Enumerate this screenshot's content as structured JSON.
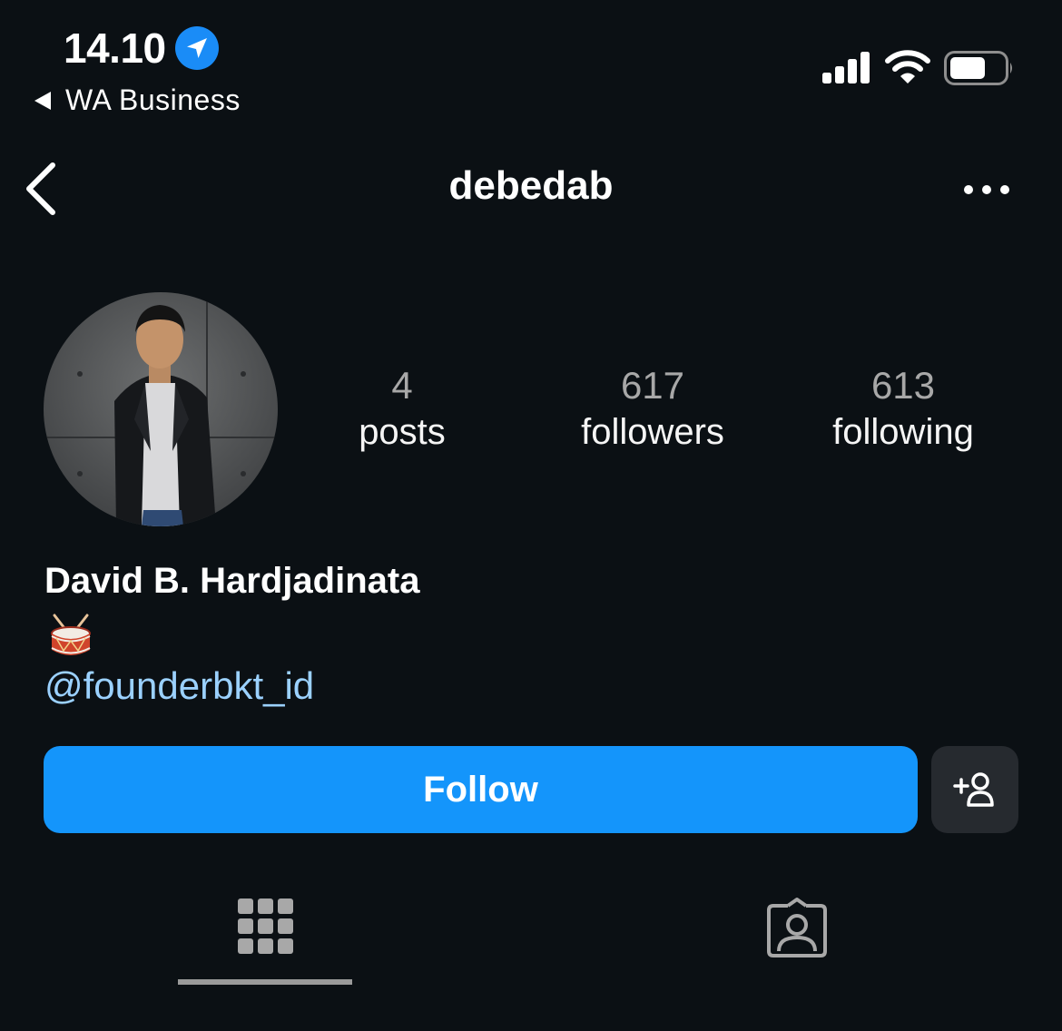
{
  "status_bar": {
    "time": "14.10",
    "back_app": "WA Business",
    "location_icon": "location-arrow-icon",
    "signal_icon": "cellular-signal-icon",
    "wifi_icon": "wifi-icon",
    "battery_icon": "battery-icon"
  },
  "header": {
    "username": "debedab",
    "back_icon": "chevron-left-icon",
    "more_icon": "more-horizontal-icon"
  },
  "profile": {
    "stats": [
      {
        "value": "4",
        "label": "posts"
      },
      {
        "value": "617",
        "label": "followers"
      },
      {
        "value": "613",
        "label": "following"
      }
    ],
    "full_name": "David B. Hardjadinata",
    "bio_icon": "drum-icon",
    "mention": "@founderbkt_id"
  },
  "actions": {
    "follow_label": "Follow",
    "suggest_icon": "add-person-icon"
  },
  "tabs": [
    {
      "name": "posts-grid",
      "icon": "grid-icon",
      "active": true
    },
    {
      "name": "tagged",
      "icon": "tagged-person-icon",
      "active": false
    }
  ],
  "colors": {
    "background": "#0b1014",
    "accent": "#1495fb",
    "link": "#9bd1ff",
    "secondary_button": "#262a2f"
  }
}
